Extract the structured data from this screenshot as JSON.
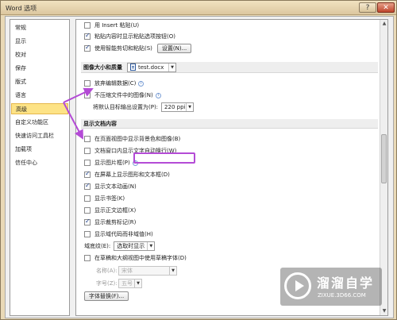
{
  "window": {
    "title": "Word 选项",
    "help_glyph": "?",
    "close_glyph": "✕"
  },
  "sidebar": {
    "items": [
      {
        "label": "常规",
        "active": false
      },
      {
        "label": "显示",
        "active": false
      },
      {
        "label": "校对",
        "active": false
      },
      {
        "label": "保存",
        "active": false
      },
      {
        "label": "版式",
        "active": false
      },
      {
        "label": "语言",
        "active": false
      },
      {
        "label": "高级",
        "active": true
      },
      {
        "label": "自定义功能区",
        "active": false
      },
      {
        "label": "快速访问工具栏",
        "active": false
      },
      {
        "label": "加载项",
        "active": false
      },
      {
        "label": "信任中心",
        "active": false
      }
    ]
  },
  "content": {
    "top_options": [
      {
        "label": "用 Insert 粘贴(U)",
        "checked": false
      },
      {
        "label": "粘贴内容时显示粘贴选项按钮(O)",
        "checked": true
      },
      {
        "label": "使用智能剪切和粘贴(S)",
        "checked": true,
        "button": "设置(N)..."
      }
    ],
    "image_section": {
      "header": "图像大小和质量",
      "file": "test.docx",
      "options": [
        {
          "label": "放弃编辑数据(C)",
          "checked": false,
          "info": true
        },
        {
          "label": "不压缩文件中的图像(N)",
          "checked": false,
          "info": true
        }
      ],
      "resolution_label": "将默认目标输出设置为(P):",
      "resolution_value": "220 ppi"
    },
    "display_section": {
      "header": "显示文档内容",
      "options": [
        {
          "label": "在页面视图中显示背景色和图像(B)",
          "checked": false
        },
        {
          "label": "文档窗口内显示文字自动换行(W)",
          "checked": false
        },
        {
          "label": "显示图片框(P)",
          "checked": false,
          "info": true
        },
        {
          "label": "在屏幕上显示图形和文本框(D)",
          "checked": true
        },
        {
          "label": "显示文本动画(N)",
          "checked": true
        },
        {
          "label": "显示书签(K)",
          "checked": false
        },
        {
          "label": "显示正文边框(X)",
          "checked": false
        },
        {
          "label": "显示裁剪标记(R)",
          "checked": true
        },
        {
          "label": "显示域代码而非域值(H)",
          "checked": false
        }
      ],
      "shading_label": "域底纹(E):",
      "shading_value": "选取时显示",
      "draft_font_label": "在草稿和大纲视图中使用草稿字体(D)",
      "font_name_label": "名称(A):",
      "font_name_value": "宋体",
      "font_size_label": "字号(Z):",
      "font_size_value": "五号",
      "font_substitution_button": "字体替换(F)..."
    },
    "dropdown_arrow": "▼"
  },
  "watermark": {
    "title": "溜溜自学",
    "subtitle": "ZIXUE.3D66.COM"
  },
  "colors": {
    "accent_highlight": "#b44bd6",
    "active_nav": "#fde386"
  }
}
